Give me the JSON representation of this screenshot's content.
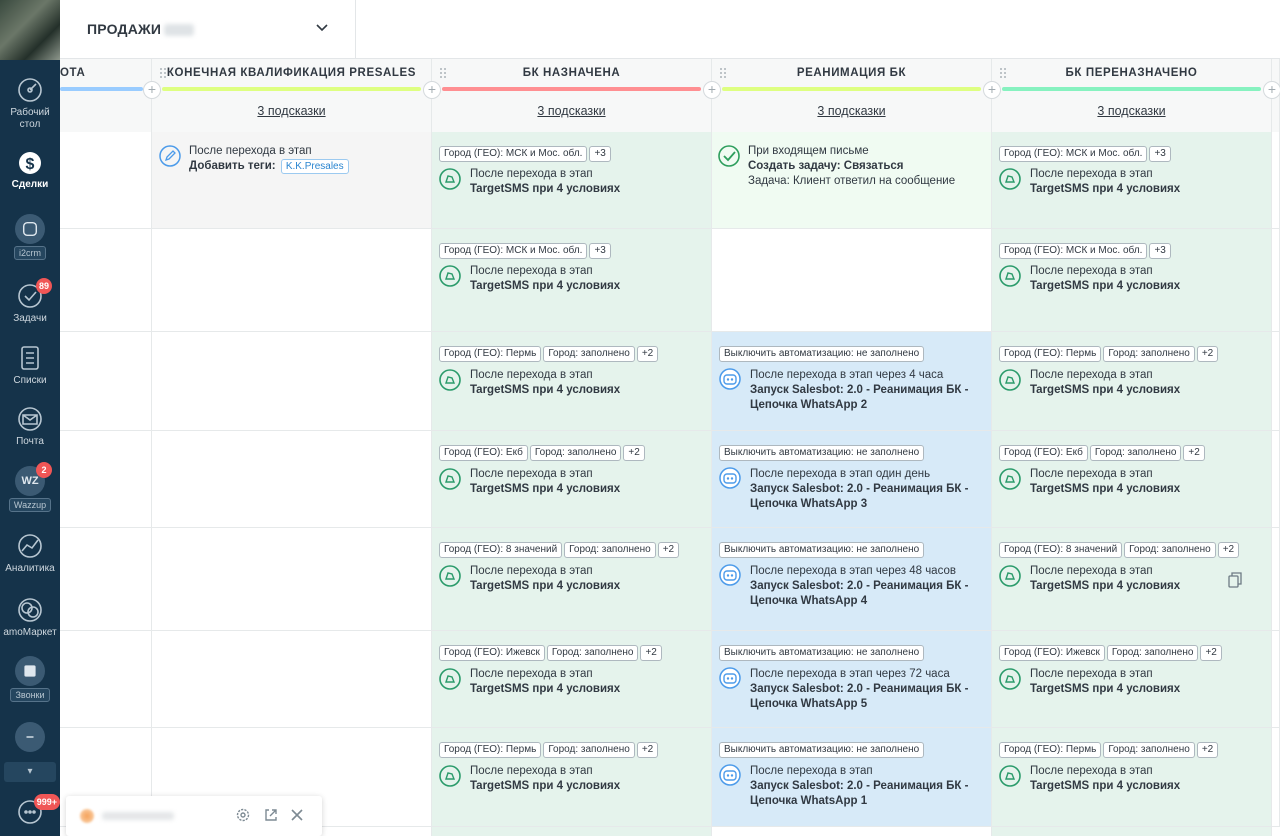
{
  "pipeline": {
    "title": "ПРОДАЖИ"
  },
  "sidebar": {
    "items": [
      {
        "label": "Рабочий\nстол",
        "icon": "dashboard-icon"
      },
      {
        "label": "Сделки",
        "icon": "deals-icon"
      },
      {
        "label": "i2crm",
        "icon": "i2crm-icon"
      },
      {
        "label": "Задачи",
        "icon": "tasks-icon",
        "badge": "89"
      },
      {
        "label": "Списки",
        "icon": "lists-icon"
      },
      {
        "label": "Почта",
        "icon": "mail-icon"
      },
      {
        "label": "Wazzup",
        "icon": "wazzup-icon",
        "badge": "2"
      },
      {
        "label": "Аналитика",
        "icon": "analytics-icon"
      },
      {
        "label": "amoМаркет",
        "icon": "market-icon"
      },
      {
        "label": "Звонки",
        "icon": "calls-icon"
      },
      {
        "label": "",
        "icon": "chat-widget-icon",
        "badge": "999+"
      }
    ]
  },
  "columns": [
    {
      "name": "ОТА",
      "hints": "",
      "color": "#99ccff"
    },
    {
      "name": "КОНЕЧНАЯ КВАЛИФИКАЦИЯ PRESALES",
      "hints": "3 подсказки",
      "color": "#deff81"
    },
    {
      "name": "БК НАЗНАЧЕНА",
      "hints": "3 подсказки",
      "color": "#ff8f92"
    },
    {
      "name": "РЕАНИМАЦИЯ БК",
      "hints": "3 подсказки",
      "color": "#deff81"
    },
    {
      "name": "БК ПЕРЕНАЗНАЧЕНО",
      "hints": "3 подсказки",
      "color": "#87f2c0"
    }
  ],
  "cards": {
    "presales_r1": {
      "trigger": "После перехода в этап",
      "action_label": "Добавить теги:",
      "tag": "K.K.Presales"
    },
    "reanim_r1": {
      "trigger": "При входящем письме",
      "action": "Создать задачу: Связаться",
      "detail": "Задача: Клиент ответил на сообщение"
    },
    "rows": [
      {
        "bk_tags": [
          "Город (ГЕО): МСК и Мос. обл.",
          "+3"
        ],
        "bk_trigger": "После перехода в этап",
        "bk_action": "TargetSMS при 4 условиях",
        "pere_tags": [
          "Город (ГЕО): МСК и Мос. обл.",
          "+3"
        ],
        "pere_trigger": "После перехода в этап",
        "pere_action": "TargetSMS при 4 условиях"
      },
      {
        "bk_tags": [
          "Город (ГЕО): МСК и Мос. обл.",
          "+3"
        ],
        "bk_trigger": "После перехода в этап",
        "bk_action": "TargetSMS при 4 условиях",
        "pere_tags": [
          "Город (ГЕО): МСК и Мос. обл.",
          "+3"
        ],
        "pere_trigger": "После перехода в этап",
        "pere_action": "TargetSMS при 4 условиях"
      },
      {
        "bk_tags": [
          "Город (ГЕО): Пермь",
          "Город: заполнено",
          "+2"
        ],
        "bk_trigger": "После перехода в этап",
        "bk_action": "TargetSMS при 4 условиях",
        "re_tag": "Выключить автоматизацию: не заполнено",
        "re_trigger": "После перехода в этап через 4 часа",
        "re_action": "Запуск Salesbot: 2.0 - Реанимация БК - Цепочка WhatsApp 2",
        "pere_tags": [
          "Город (ГЕО): Пермь",
          "Город: заполнено",
          "+2"
        ],
        "pere_trigger": "После перехода в этап",
        "pere_action": "TargetSMS при 4 условиях"
      },
      {
        "bk_tags": [
          "Город (ГЕО): Екб",
          "Город: заполнено",
          "+2"
        ],
        "bk_trigger": "После перехода в этап",
        "bk_action": "TargetSMS при 4 условиях",
        "re_tag": "Выключить автоматизацию: не заполнено",
        "re_trigger": "После перехода в этап один день",
        "re_action": "Запуск Salesbot: 2.0 - Реанимация БК - Цепочка WhatsApp 3",
        "pere_tags": [
          "Город (ГЕО): Екб",
          "Город: заполнено",
          "+2"
        ],
        "pere_trigger": "После перехода в этап",
        "pere_action": "TargetSMS при 4 условиях"
      },
      {
        "bk_tags": [
          "Город (ГЕО): 8 значений",
          "Город: заполнено",
          "+2"
        ],
        "bk_trigger": "После перехода в этап",
        "bk_action": "TargetSMS при 4 условиях",
        "re_tag": "Выключить автоматизацию: не заполнено",
        "re_trigger": "После перехода в этап через 48 часов",
        "re_action": "Запуск Salesbot: 2.0 - Реанимация БК - Цепочка WhatsApp 4",
        "pere_tags": [
          "Город (ГЕО): 8 значений",
          "Город: заполнено",
          "+2"
        ],
        "pere_trigger": "После перехода в этап",
        "pere_action": "TargetSMS при 4 условиях"
      },
      {
        "bk_tags": [
          "Город (ГЕО): Ижевск",
          "Город: заполнено",
          "+2"
        ],
        "bk_trigger": "После перехода в этап",
        "bk_action": "TargetSMS при 4 условиях",
        "re_tag": "Выключить автоматизацию: не заполнено",
        "re_trigger": "После перехода в этап через 72 часа",
        "re_action": "Запуск Salesbot: 2.0 - Реанимация БК - Цепочка WhatsApp 5",
        "pere_tags": [
          "Город (ГЕО): Ижевск",
          "Город: заполнено",
          "+2"
        ],
        "pere_trigger": "После перехода в этап",
        "pere_action": "TargetSMS при 4 условиях"
      },
      {
        "bk_tags": [
          "Город (ГЕО): Пермь",
          "Город: заполнено",
          "+2"
        ],
        "bk_trigger": "После перехода в этап",
        "bk_action": "TargetSMS при 4 условиях",
        "re_tag": "Выключить автоматизацию: не заполнено",
        "re_trigger": "После перехода в этап",
        "re_action": "Запуск Salesbot: 2.0 - Реанимация БК - Цепочка WhatsApp 1",
        "pere_tags": [
          "Город (ГЕО): Пермь",
          "Город: заполнено",
          "+2"
        ],
        "pere_trigger": "После перехода в этап",
        "pere_action": "TargetSMS при 4 условиях"
      }
    ]
  },
  "colors": {
    "sidebar_bg": "#15334a",
    "card_green": "#e5f3ec",
    "card_blue": "#d7eaf8",
    "badge_red": "#f05656",
    "accent_green": "#2b9b6b"
  }
}
